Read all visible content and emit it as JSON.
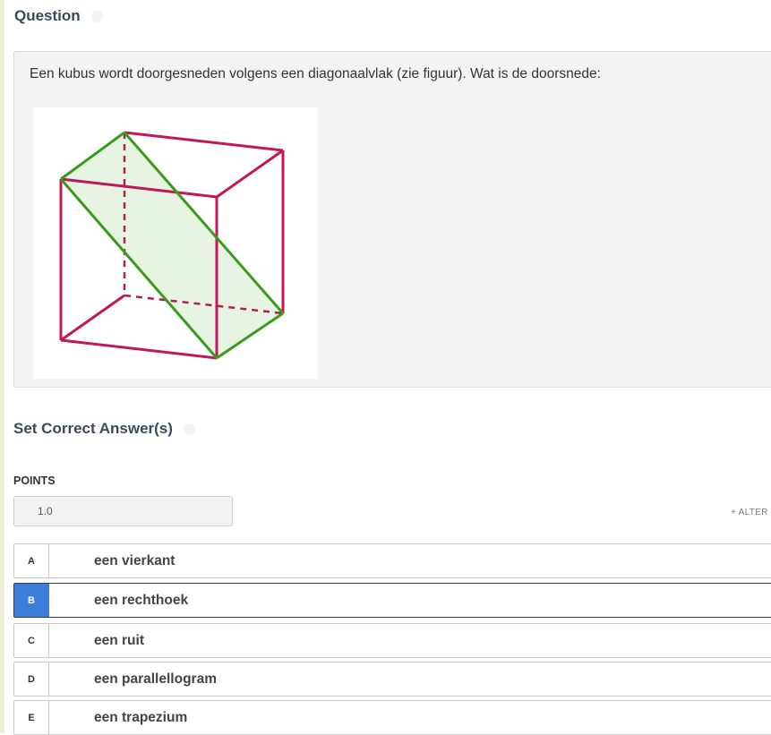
{
  "question": {
    "heading": "Question",
    "text": "Een kubus wordt doorgesneden volgens een diagonaalvlak (zie figuur). Wat is de doorsnede:"
  },
  "answers": {
    "heading": "Set Correct Answer(s)",
    "points_label": "POINTS",
    "points_value": "1.0",
    "alter_link": "+ ALTER",
    "selected": "B",
    "options": [
      {
        "letter": "A",
        "text": "een vierkant"
      },
      {
        "letter": "B",
        "text": "een rechthoek"
      },
      {
        "letter": "C",
        "text": "een ruit"
      },
      {
        "letter": "D",
        "text": "een parallellogram"
      },
      {
        "letter": "E",
        "text": "een trapezium"
      }
    ]
  },
  "colors": {
    "cube_edges": "#c2185b",
    "cross_section": "#3a9a1e",
    "cross_section_fill": "#e8f4e2",
    "selected_accent": "#3b7dd8"
  },
  "icons": {
    "heading_info": "info-icon"
  }
}
